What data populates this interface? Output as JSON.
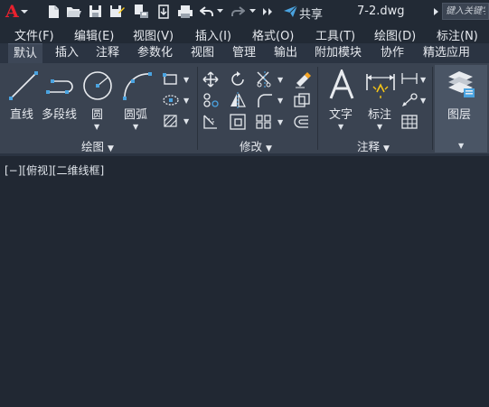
{
  "title_bar": {
    "logo_letter": "A",
    "share_label": "共享",
    "file_title": "7-2.dwg",
    "search_placeholder": "键入关键字"
  },
  "quick_access_icons": [
    "new-icon",
    "open-icon",
    "save-icon",
    "save-as-icon",
    "plot-preview-icon",
    "publish-icon",
    "print-icon",
    "undo-icon",
    "redo-icon",
    "more-icon"
  ],
  "menu": {
    "items": [
      "文件(F)",
      "编辑(E)",
      "视图(V)",
      "插入(I)",
      "格式(O)",
      "工具(T)",
      "绘图(D)",
      "标注(N)"
    ]
  },
  "ribbon_tabs": {
    "items": [
      "默认",
      "插入",
      "注释",
      "参数化",
      "视图",
      "管理",
      "输出",
      "附加模块",
      "协作",
      "精选应用"
    ],
    "active": "默认"
  },
  "panels": {
    "draw": {
      "title": "绘图",
      "tools": [
        "直线",
        "多段线",
        "圆",
        "圆弧"
      ]
    },
    "modify": {
      "title": "修改"
    },
    "annotate": {
      "title": "注释",
      "tools": [
        "文字",
        "标注"
      ]
    },
    "layers": {
      "title": "图层"
    }
  },
  "viewport": {
    "controls": "[−][俯视][二维线框]"
  },
  "colors": {
    "background": "#212833",
    "ribbon": "#3a4351",
    "accent_blue": "#4aa3e0",
    "logo_red": "#e8212e",
    "highlight_yellow": "#f5c518"
  }
}
